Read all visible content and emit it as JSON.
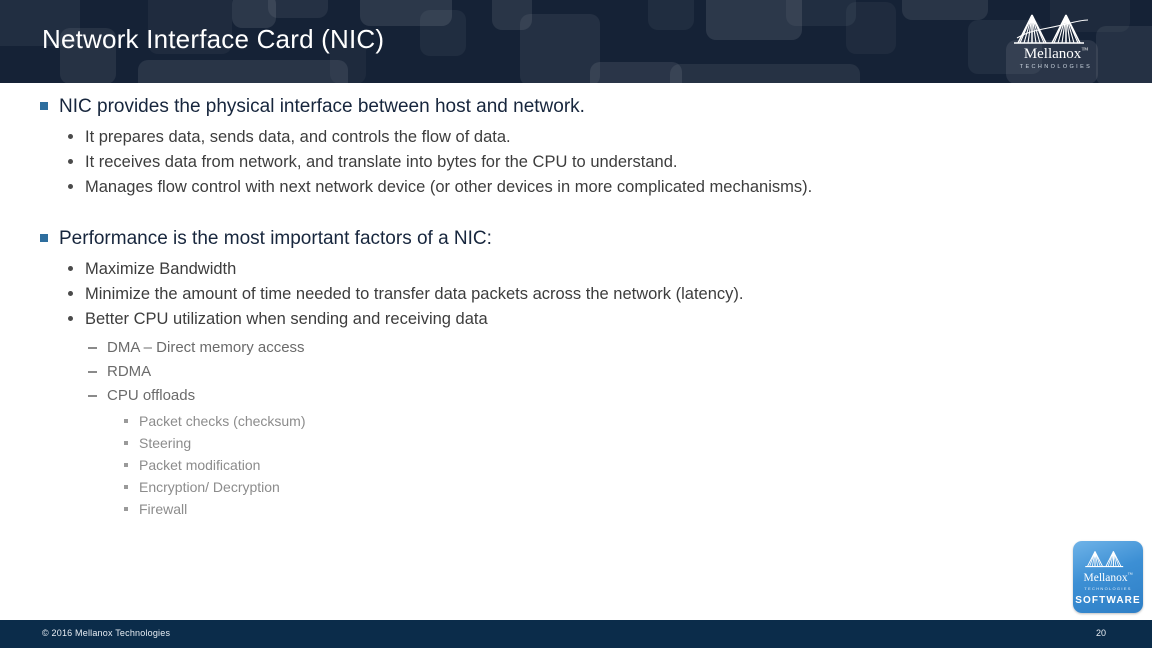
{
  "header": {
    "title": "Network Interface Card (NIC)",
    "bg_color": "#152236",
    "title_color": "#ffffff",
    "logo": {
      "name": "mellanox-logo",
      "wordmark": "Mellanox",
      "trademark": "™",
      "tagline": "TECHNOLOGIES"
    }
  },
  "colors": {
    "level1_bullet": "#2e6e9e",
    "level1_text": "#17263d",
    "level2_text": "#3d3d3d",
    "level3_text": "#6b6b6b",
    "level4_text": "#8c8c8c",
    "footer_bg": "#0b2c4a",
    "badge_blue": "#3c8fd4"
  },
  "body": {
    "sections": [
      {
        "heading": "NIC provides the physical interface between host and network.",
        "items": [
          "It prepares data, sends data, and controls the flow of data.",
          "It receives data from network, and translate into bytes for the CPU to understand.",
          "Manages flow control with next network device (or other devices in more complicated mechanisms)."
        ]
      },
      {
        "heading": "Performance is the most important factors of a NIC:",
        "items": [
          "Maximize Bandwidth",
          "Minimize the amount of time needed to transfer data packets across the network (latency).",
          "Better CPU utilization when sending and receiving data"
        ],
        "level3": [
          "DMA – Direct memory access",
          "RDMA",
          "CPU offloads"
        ],
        "level4": [
          "Packet checks (checksum)",
          "Steering",
          "Packet modification",
          "Encryption/ Decryption",
          "Firewall"
        ]
      }
    ]
  },
  "badge": {
    "name": "mellanox-software-badge",
    "wordmark": "Mellanox",
    "trademark": "™",
    "tagline": "TECHNOLOGIES",
    "product": "SOFTWARE"
  },
  "footer": {
    "copyright": "© 2016 Mellanox Technologies",
    "page_number": "20"
  }
}
